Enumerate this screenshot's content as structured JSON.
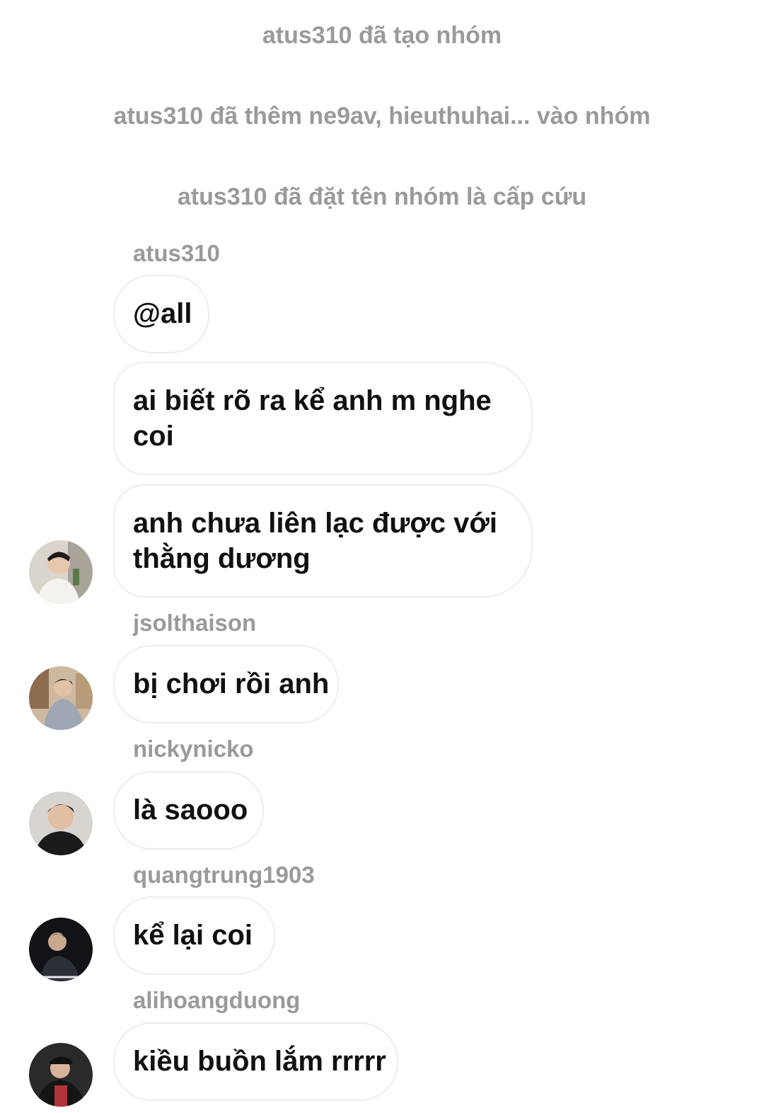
{
  "system_messages": [
    "atus310 đã tạo nhóm",
    "atus310 đã thêm ne9av, hieuthuhai... vào nhóm",
    "atus310 đã đặt tên nhóm là cấp cứu"
  ],
  "messages": [
    {
      "sender": "atus310",
      "bubbles": [
        "@all",
        "ai biết rõ ra kể anh m nghe coi",
        "anh chưa liên lạc được với thằng dương"
      ],
      "avatar_icon": "user-avatar-icon"
    },
    {
      "sender": "jsolthaison",
      "bubbles": [
        "bị chơi rồi anh"
      ],
      "avatar_icon": "user-avatar-icon"
    },
    {
      "sender": "nickynicko",
      "bubbles": [
        "là saooo"
      ],
      "avatar_icon": "user-avatar-icon"
    },
    {
      "sender": "quangtrung1903",
      "bubbles": [
        "kể lại coi"
      ],
      "avatar_icon": "user-avatar-icon"
    },
    {
      "sender": "alihoangduong",
      "bubbles": [
        "kiều buồn lắm rrrrr"
      ],
      "avatar_icon": "user-avatar-icon"
    }
  ]
}
